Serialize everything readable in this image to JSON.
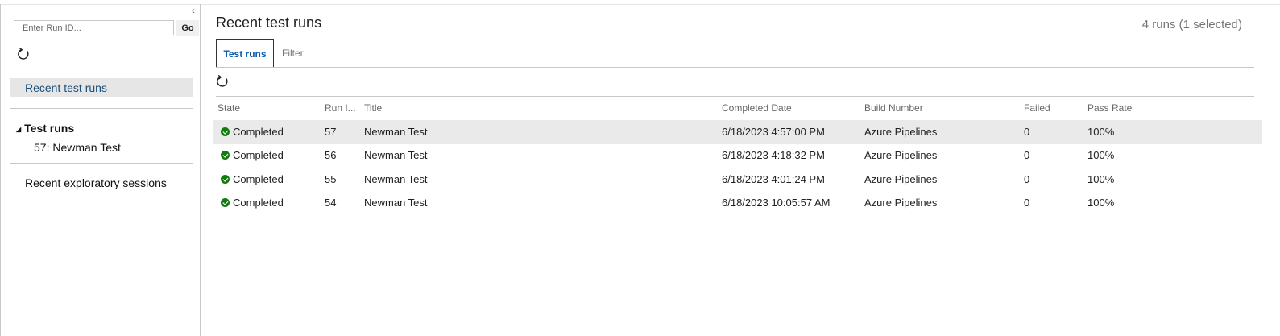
{
  "sidebar": {
    "run_id_placeholder": "Enter Run ID...",
    "go_label": "Go",
    "nav_selected": "Recent test runs",
    "tree_header": "Test runs",
    "tree_items": [
      "57: Newman Test"
    ],
    "exploratory": "Recent exploratory sessions"
  },
  "main": {
    "title": "Recent test runs",
    "run_count": "4 runs (1 selected)",
    "tabs": [
      {
        "label": "Test runs",
        "active": true
      },
      {
        "label": "Filter",
        "active": false
      }
    ],
    "columns": [
      "State",
      "Run I...",
      "Title",
      "Completed Date",
      "Build Number",
      "Failed",
      "Pass Rate"
    ],
    "rows": [
      {
        "state": "Completed",
        "run_id": "57",
        "title": "Newman Test",
        "completed": "6/18/2023 4:57:00 PM",
        "build": "Azure Pipelines",
        "failed": "0",
        "pass_rate": "100%"
      },
      {
        "state": "Completed",
        "run_id": "56",
        "title": "Newman Test",
        "completed": "6/18/2023 4:18:32 PM",
        "build": "Azure Pipelines",
        "failed": "0",
        "pass_rate": "100%"
      },
      {
        "state": "Completed",
        "run_id": "55",
        "title": "Newman Test",
        "completed": "6/18/2023 4:01:24 PM",
        "build": "Azure Pipelines",
        "failed": "0",
        "pass_rate": "100%"
      },
      {
        "state": "Completed",
        "run_id": "54",
        "title": "Newman Test",
        "completed": "6/18/2023 10:05:57 AM",
        "build": "Azure Pipelines",
        "failed": "0",
        "pass_rate": "100%"
      }
    ]
  },
  "colors": {
    "accent": "#0b5cad",
    "success": "#107c10",
    "selected_row": "#eaeaea"
  },
  "icons": [
    "collapse-icon",
    "refresh-icon",
    "tree-expanded-icon",
    "success-check-icon"
  ]
}
